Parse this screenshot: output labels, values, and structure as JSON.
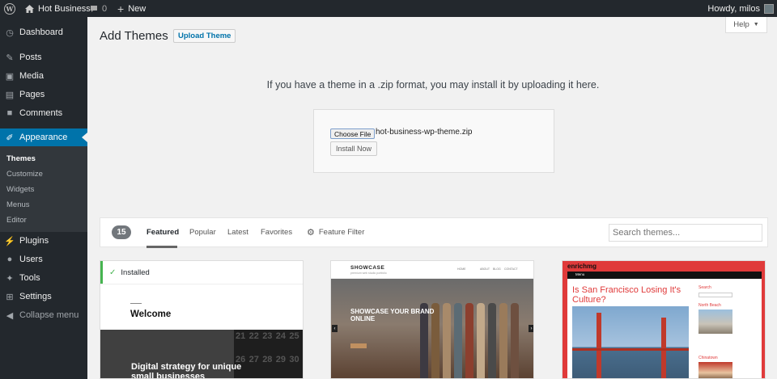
{
  "admin_bar": {
    "site_name": "Hot Business",
    "comment_count": "0",
    "new_label": "New",
    "howdy": "Howdy, milos"
  },
  "sidebar": {
    "items": [
      {
        "label": "Dashboard",
        "icon": "dashboard-icon"
      },
      {
        "label": "Posts",
        "icon": "pin-icon"
      },
      {
        "label": "Media",
        "icon": "media-icon"
      },
      {
        "label": "Pages",
        "icon": "pages-icon"
      },
      {
        "label": "Comments",
        "icon": "comment-icon"
      },
      {
        "label": "Appearance",
        "icon": "brush-icon"
      },
      {
        "label": "Plugins",
        "icon": "plug-icon"
      },
      {
        "label": "Users",
        "icon": "user-icon"
      },
      {
        "label": "Tools",
        "icon": "wrench-icon"
      },
      {
        "label": "Settings",
        "icon": "settings-icon"
      },
      {
        "label": "Collapse menu",
        "icon": "collapse-icon"
      }
    ],
    "submenu": [
      "Themes",
      "Customize",
      "Widgets",
      "Menus",
      "Editor"
    ]
  },
  "header": {
    "title": "Add Themes",
    "upload_button": "Upload Theme",
    "help": "Help"
  },
  "upload": {
    "instructions": "If you have a theme in a .zip format, you may install it by uploading it here.",
    "choose_file": "Choose File",
    "filename": "hot-business-wp-theme.zip",
    "install_now": "Install Now"
  },
  "filters": {
    "count": "15",
    "tabs": [
      "Featured",
      "Popular",
      "Latest",
      "Favorites"
    ],
    "feature_filter": "Feature Filter",
    "search_placeholder": "Search themes..."
  },
  "themes": {
    "card1": {
      "installed": "Installed",
      "welcome": "Welcome",
      "tagline": "Digital strategy for unique small businesses",
      "calendar": [
        "21",
        "22",
        "23",
        "24",
        "25",
        "26",
        "27",
        "28",
        "29",
        "30"
      ]
    },
    "card2": {
      "logo": "SHOWCASE",
      "tag": "premium web studio portfolio",
      "nav": [
        "HOME",
        "ABOUT",
        "BLOG",
        "CONTACT"
      ],
      "hero": "SHOWCASE YOUR BRAND ONLINE"
    },
    "card3": {
      "logo": "enrichmg",
      "nav": "Menu",
      "headline": "Is San Francisco Losing It's Culture?",
      "search": "Search",
      "side1": "North Beach",
      "side2": "Chinatown"
    }
  },
  "colors": {
    "adminbar": "#23282d",
    "accent": "#0073aa",
    "installed": "#46b450",
    "enrich_red": "#e03a3a"
  }
}
